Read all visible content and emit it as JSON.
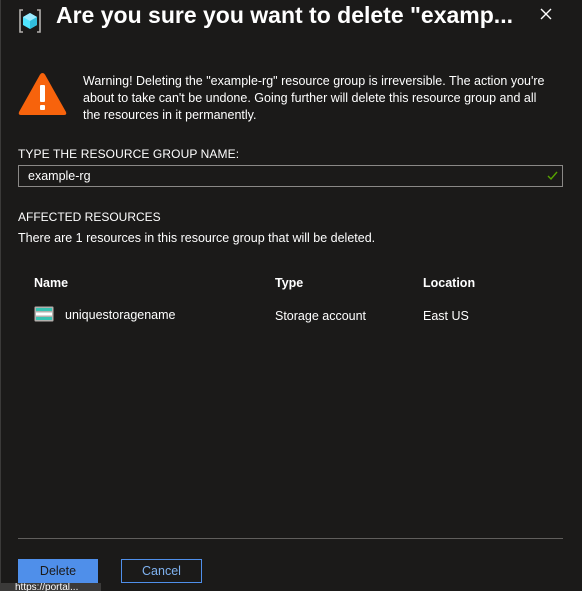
{
  "dialog": {
    "title": "Are you sure you want to delete \"examp...",
    "close_icon": "close-icon"
  },
  "warning": {
    "icon": "warning-icon",
    "text": "Warning! Deleting the \"example-rg\" resource group is irreversible. The action you're about to take can't be undone. Going further will delete this resource group and all the resources in it permanently."
  },
  "confirm_field": {
    "label": "TYPE THE RESOURCE GROUP NAME:",
    "value": "example-rg",
    "valid": true
  },
  "affected": {
    "heading": "AFFECTED RESOURCES",
    "description": "There are 1 resources in this resource group that will be deleted.",
    "columns": [
      "Name",
      "Type",
      "Location"
    ],
    "rows": [
      {
        "name": "uniquestoragename",
        "type": "Storage account",
        "location": "East US",
        "icon": "storage-account-icon"
      }
    ]
  },
  "buttons": {
    "delete": "Delete",
    "cancel": "Cancel"
  },
  "tooltip": {
    "text": "https://portal..."
  },
  "colors": {
    "background": "#1b1a19",
    "primary": "#4f8fea",
    "warning": "#f7630c",
    "success": "#57a300",
    "border": "#8a8886"
  }
}
